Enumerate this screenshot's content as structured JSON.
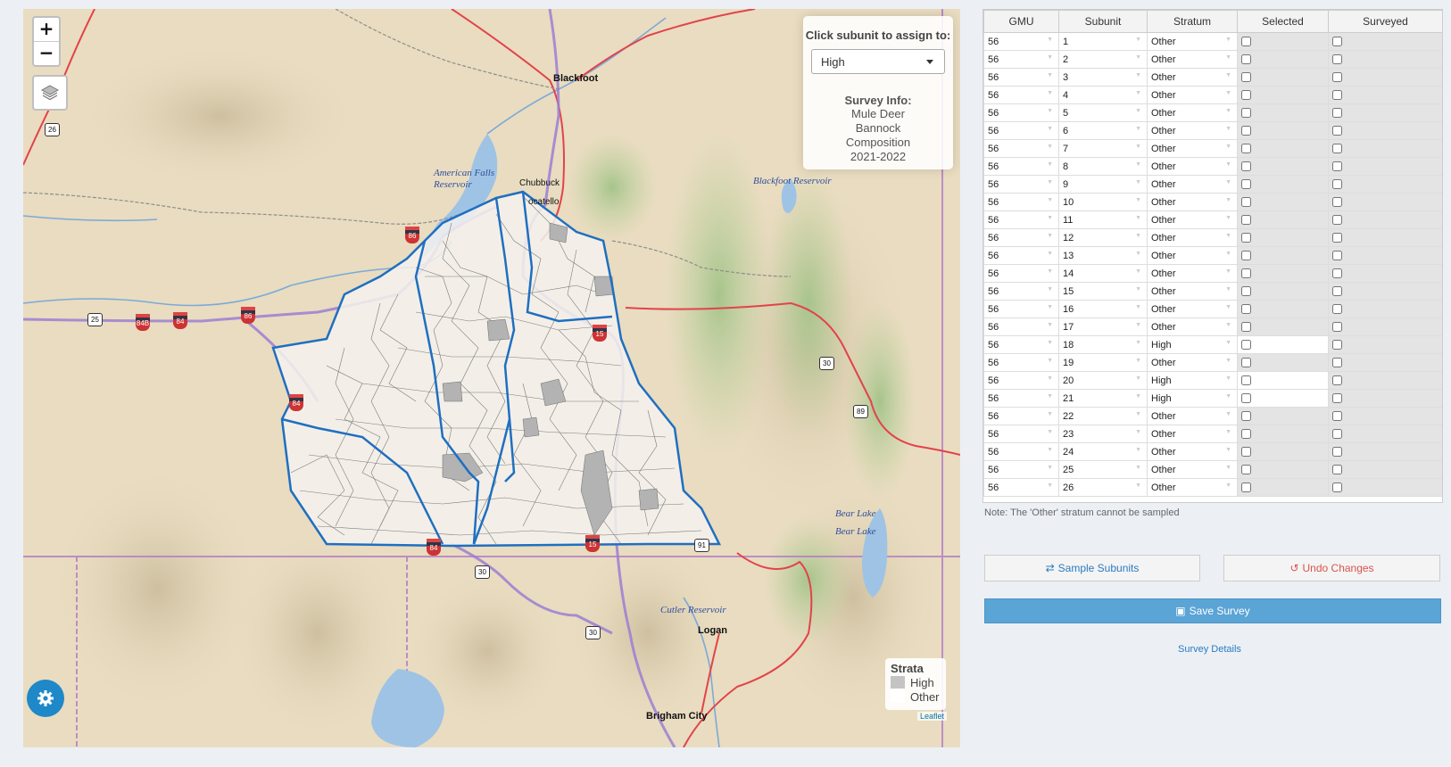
{
  "map": {
    "zoom_in": "+",
    "zoom_out": "−",
    "layers_icon": "layers-icon",
    "assign_panel": {
      "title": "Click subunit to assign to:",
      "selected": "High",
      "info_title": "Survey Info:",
      "info_lines": [
        "Mule Deer",
        "Bannock",
        "Composition",
        "2021-2022"
      ]
    },
    "legend": {
      "title": "Strata",
      "items": [
        {
          "label": "High",
          "color": "#c4c4c4"
        },
        {
          "label": "Other",
          "color": "#ffffff"
        }
      ]
    },
    "place_labels": {
      "blackfoot": "Blackfoot",
      "chubbuck": "Chubbuck",
      "pocatello": "ocatello",
      "logan": "Logan",
      "brigham": "Brigham City"
    },
    "water_labels": {
      "american_falls": "American Falls",
      "american_falls_2": "Reservoir",
      "blackfoot_res": "Blackfoot Reservoir",
      "bear_lake_1": "Bear Lake",
      "bear_lake_2": "Bear Lake",
      "cutler": "Cutler Reservoir"
    },
    "shields": {
      "us26": "26",
      "us25": "25",
      "i84b": "84B",
      "i84a": "84",
      "i86": "86",
      "i84c": "84",
      "i15n": "15",
      "i15s": "15",
      "us30n": "30",
      "us89": "89",
      "i84d": "84",
      "us30s": "30",
      "us30c": "30",
      "us91": "91",
      "i86b": "86"
    },
    "attribution": "Leaflet",
    "settings_icon": "gear-icon",
    "colors": {
      "boundary": "#1f6fc0",
      "high": "#b3b3b3",
      "road_red": "#e2434b",
      "interstate": "#9b7fd4"
    }
  },
  "table": {
    "columns": [
      "GMU",
      "Subunit",
      "Stratum",
      "Selected",
      "Surveyed"
    ],
    "rows": [
      {
        "gmu": "56",
        "subunit": "1",
        "stratum": "Other"
      },
      {
        "gmu": "56",
        "subunit": "2",
        "stratum": "Other"
      },
      {
        "gmu": "56",
        "subunit": "3",
        "stratum": "Other"
      },
      {
        "gmu": "56",
        "subunit": "4",
        "stratum": "Other"
      },
      {
        "gmu": "56",
        "subunit": "5",
        "stratum": "Other"
      },
      {
        "gmu": "56",
        "subunit": "6",
        "stratum": "Other"
      },
      {
        "gmu": "56",
        "subunit": "7",
        "stratum": "Other"
      },
      {
        "gmu": "56",
        "subunit": "8",
        "stratum": "Other"
      },
      {
        "gmu": "56",
        "subunit": "9",
        "stratum": "Other"
      },
      {
        "gmu": "56",
        "subunit": "10",
        "stratum": "Other"
      },
      {
        "gmu": "56",
        "subunit": "11",
        "stratum": "Other"
      },
      {
        "gmu": "56",
        "subunit": "12",
        "stratum": "Other"
      },
      {
        "gmu": "56",
        "subunit": "13",
        "stratum": "Other"
      },
      {
        "gmu": "56",
        "subunit": "14",
        "stratum": "Other"
      },
      {
        "gmu": "56",
        "subunit": "15",
        "stratum": "Other"
      },
      {
        "gmu": "56",
        "subunit": "16",
        "stratum": "Other"
      },
      {
        "gmu": "56",
        "subunit": "17",
        "stratum": "Other"
      },
      {
        "gmu": "56",
        "subunit": "18",
        "stratum": "High"
      },
      {
        "gmu": "56",
        "subunit": "19",
        "stratum": "Other"
      },
      {
        "gmu": "56",
        "subunit": "20",
        "stratum": "High"
      },
      {
        "gmu": "56",
        "subunit": "21",
        "stratum": "High"
      },
      {
        "gmu": "56",
        "subunit": "22",
        "stratum": "Other"
      },
      {
        "gmu": "56",
        "subunit": "23",
        "stratum": "Other"
      },
      {
        "gmu": "56",
        "subunit": "24",
        "stratum": "Other"
      },
      {
        "gmu": "56",
        "subunit": "25",
        "stratum": "Other"
      },
      {
        "gmu": "56",
        "subunit": "26",
        "stratum": "Other"
      }
    ],
    "note": "Note: The 'Other' stratum cannot be sampled"
  },
  "actions": {
    "sample": "Sample Subunits",
    "sample_icon": "shuffle-icon",
    "undo": "Undo Changes",
    "undo_icon": "undo-icon",
    "save": "Save Survey",
    "save_icon": "save-icon",
    "details": "Survey Details"
  }
}
